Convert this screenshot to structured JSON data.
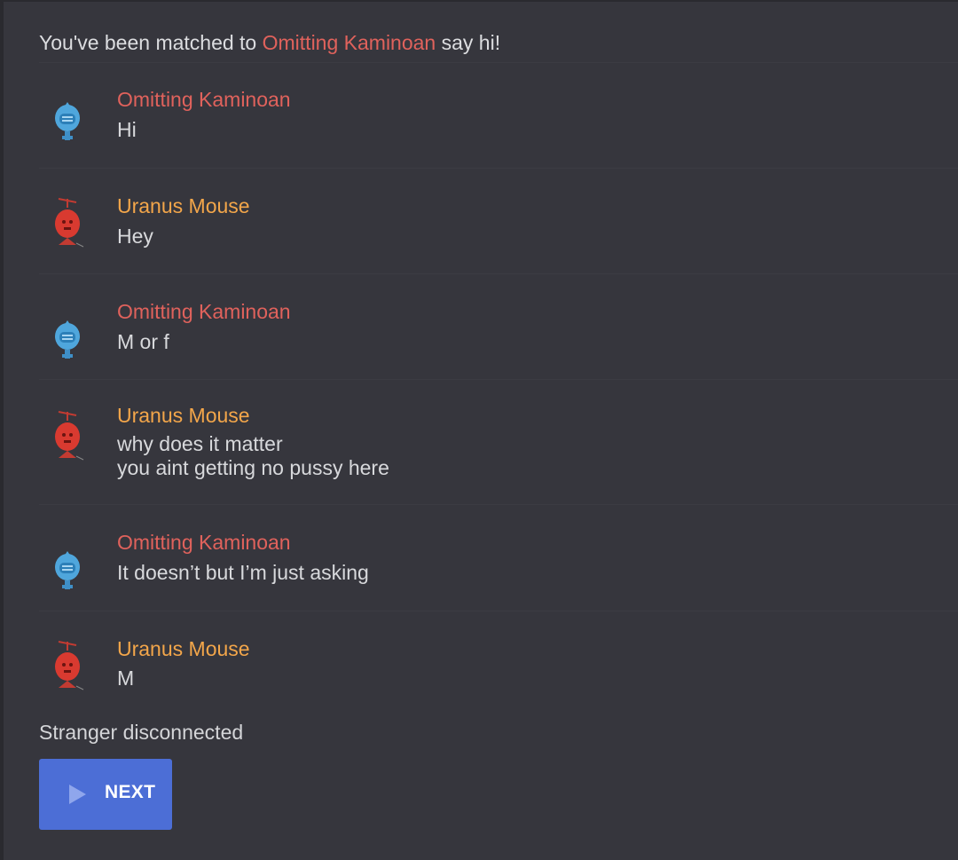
{
  "header": {
    "prefix": "You've been matched to",
    "stranger_name": "Omitting Kaminoan",
    "suffix": "say hi!"
  },
  "messages": [
    {
      "author": "Omitting Kaminoan",
      "lines": [
        "Hi"
      ]
    },
    {
      "author": "Uranus Mouse",
      "lines": [
        "Hey"
      ]
    },
    {
      "author": "Omitting Kaminoan",
      "lines": [
        "M or f"
      ]
    },
    {
      "author": "Uranus Mouse",
      "lines": [
        "why does it matter",
        "you aint getting no pussy here"
      ]
    },
    {
      "author": "Omitting Kaminoan",
      "lines": [
        "It doesn’t but I’m just asking"
      ]
    },
    {
      "author": "Uranus Mouse",
      "lines": [
        "M"
      ]
    }
  ],
  "status": {
    "text": "Stranger disconnected"
  },
  "next_button": {
    "label": "NEXT",
    "icon": "play-icon"
  },
  "colors": {
    "background": "#36363d",
    "stranger_name": "#e0625c",
    "self_name": "#f3a64a",
    "button": "#4c6ed6"
  },
  "avatars": {
    "stranger": "blue-robot-avatar",
    "self": "red-robot-avatar"
  }
}
